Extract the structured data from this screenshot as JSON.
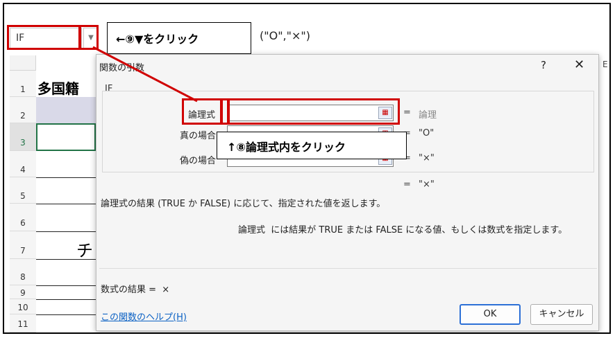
{
  "excel": {
    "name_box": "IF",
    "name_box_dropdown_icon": "chevron-down-icon",
    "formula_fragment": "(\"O\",\"×\")",
    "column_partial": "E",
    "rows": [
      "1",
      "2",
      "3",
      "4",
      "5",
      "6",
      "7",
      "8",
      "9",
      "10",
      "11"
    ],
    "cell_title_partial": "多国籍",
    "cell_chi_partial": "チ"
  },
  "dialog": {
    "title": "関数の引数",
    "help_glyph": "?",
    "close_glyph": "✕",
    "function_name": "IF",
    "args": [
      {
        "label": "論理式",
        "value": "",
        "result": "論理"
      },
      {
        "label": "真の場合",
        "value": "",
        "result": "\"O\""
      },
      {
        "label": "偽の場合",
        "value": "",
        "result": "\"×\""
      }
    ],
    "eq_sign": "=",
    "overall_result": "\"×\"",
    "description": "論理式の結果 (TRUE か FALSE) に応じて、指定された値を返します。",
    "arg_desc_label": "論理式",
    "arg_desc_text": "には結果が TRUE または FALSE になる値、もしくは数式を指定します。",
    "formula_result_label": "数式の結果 =",
    "formula_result_value": "×",
    "help_link": "この関数のヘルプ(H)",
    "ok_label": "OK",
    "cancel_label": "キャンセル"
  },
  "annotations": {
    "callout_9": "←⑨▼をクリック",
    "callout_8": "↑⑧論理式内をクリック",
    "highlight_color": "#d00000"
  }
}
